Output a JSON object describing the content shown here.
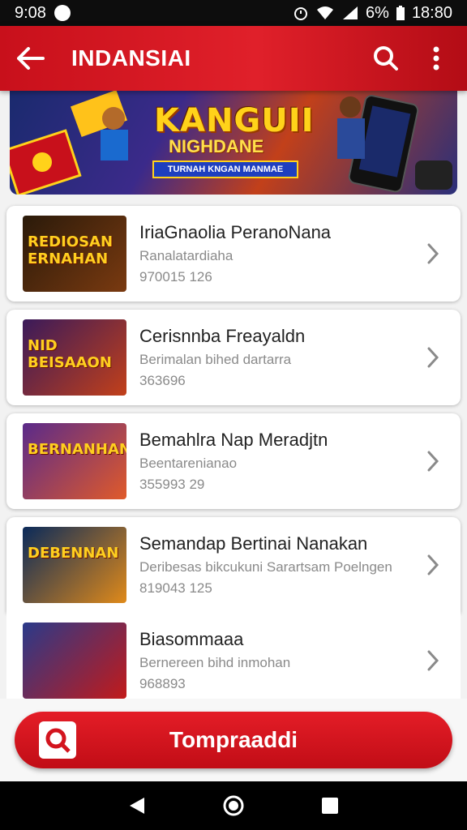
{
  "status_bar": {
    "time": "9:08",
    "battery": "6%",
    "clock": "18:80"
  },
  "app_bar": {
    "title": "INDANSIAI",
    "back_icon": "arrow-left-icon",
    "search_icon": "search-icon",
    "menu_icon": "more-vert-icon"
  },
  "banner": {
    "title": "KANGUII",
    "subtitle": "NIGHDANE",
    "ribbon": "TURNAH KNGAN MANMAE"
  },
  "items": [
    {
      "thumb_label": "REDIOSAN ERNAHAN",
      "title": "IriaGnaolia PeranoNana",
      "subtitle": "Ranalatardiaha",
      "meta": "970015 126",
      "colors": [
        "#2a1a0a",
        "#7a3a10"
      ]
    },
    {
      "thumb_label": "NID BEISAAON",
      "title": "Cerisnnba Freayaldn",
      "subtitle": "Berimalan bihed dartarra",
      "meta": "363696",
      "colors": [
        "#3a1a5a",
        "#c2401a"
      ]
    },
    {
      "thumb_label": "BERNANHAN",
      "title": "Bemahlra Nap Meradjtn",
      "subtitle": "Beentarenianao",
      "meta": "355993 29",
      "colors": [
        "#5a2a8a",
        "#e05a2a"
      ]
    },
    {
      "thumb_label": "DEBENNAN",
      "title": "Semandap Bertinai Nanakan",
      "subtitle": "Deribesas bikcukuni Sarartsam Poelngen",
      "meta": "819043 125",
      "colors": [
        "#0a2a5a",
        "#e08a1a"
      ]
    },
    {
      "thumb_label": "",
      "title": "Biasommaaa",
      "subtitle": "Bernereen bihd inmohan",
      "meta": "968893",
      "colors": [
        "#2a3a8a",
        "#c21a1a"
      ]
    }
  ],
  "primary_button": {
    "label": "Tompraaddi"
  },
  "colors": {
    "brand_red": "#d3141e",
    "card_bg": "#ffffff"
  }
}
